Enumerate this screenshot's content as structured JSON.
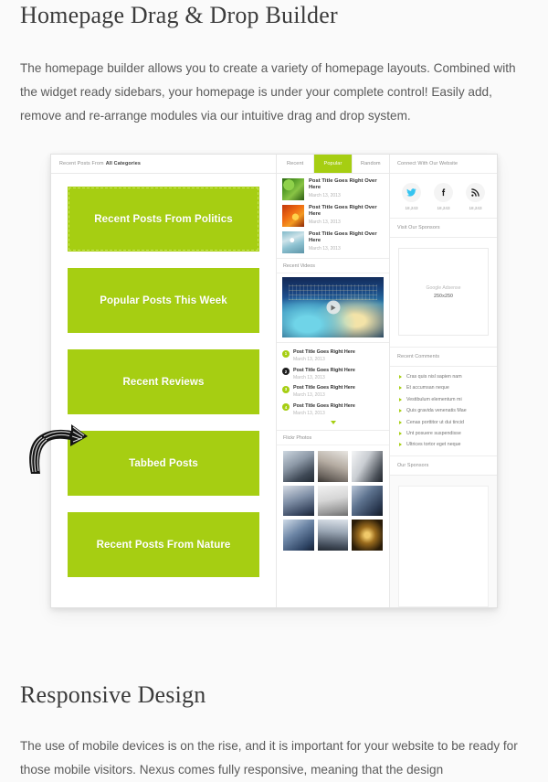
{
  "sections": {
    "top": {
      "title": "Homepage Drag & Drop Builder",
      "body": "The homepage builder allows you to create a variety of homepage layouts. Combined with the widget ready sidebars, your homepage is under your complete control! Easily add, remove and re-arrange modules via our intuitive drag and drop system."
    },
    "bottom": {
      "title": "Responsive Design",
      "body": "The use of mobile devices is on the rise, and it is important for your website to be ready for those mobile visitors. Nexus comes fully responsive, meaning that the design"
    }
  },
  "mockup": {
    "left_column": {
      "header_prefix": "Recent Posts From",
      "header_strong": "All Categories",
      "blocks": [
        {
          "label": "Recent Posts From Politics"
        },
        {
          "label": "Popular Posts This Week"
        },
        {
          "label": "Recent Reviews"
        },
        {
          "label": "Tabbed Posts"
        },
        {
          "label": "Recent Posts From Nature"
        }
      ]
    },
    "middle_column": {
      "tabs": [
        {
          "label": "Recent",
          "active": false
        },
        {
          "label": "Popular",
          "active": true
        },
        {
          "label": "Random",
          "active": false
        }
      ],
      "tab_posts": [
        {
          "title": "Post Title Goes Right Over Here",
          "date": "March 13, 2013",
          "thumb": "leaves-thumbnail"
        },
        {
          "title": "Post Title Goes Right Over Here",
          "date": "March 13, 2013",
          "thumb": "fire-thumbnail"
        },
        {
          "title": "Post Title Goes Right Over Here",
          "date": "March 13, 2013",
          "thumb": "winter-thumbnail"
        }
      ],
      "videos_header": "Recent Videos",
      "video": {
        "caption": "city-night-video-thumbnail",
        "play_icon": "play-icon"
      },
      "numbered_posts": [
        {
          "num": "1",
          "title": "Post Title Goes Right Here",
          "date": "March 13, 2013",
          "dark": false
        },
        {
          "num": "2",
          "title": "Post Title Goes Right Here",
          "date": "March 13, 2013",
          "dark": true
        },
        {
          "num": "3",
          "title": "Post Title Goes Right Here",
          "date": "March 13, 2013",
          "dark": false
        },
        {
          "num": "4",
          "title": "Post Title Goes Right Here",
          "date": "March 13, 2013",
          "dark": false
        }
      ],
      "flickr_header": "Flickr Photos",
      "flickr_count": 9
    },
    "right_column": {
      "connect_header": "Connect With Our Website",
      "socials": [
        {
          "icon": "twitter-icon",
          "count": "18,243",
          "color": "#35c4f0"
        },
        {
          "icon": "facebook-icon",
          "count": "18,243",
          "color": "#1c1c1c"
        },
        {
          "icon": "rss-icon",
          "count": "18,243",
          "color": "#1c1c1c"
        }
      ],
      "sponsors_header": "Visit Our Sponsors",
      "ad": {
        "line1": "Google Adsense",
        "line2": "250x250"
      },
      "comments_header": "Recent Comments",
      "comments": [
        "Cras quis nisl sapien nam",
        "Et accumsan neque",
        "Vestibulum elementum mi",
        "Quis gravida venenatis Mae",
        "Cenas porttitor ut dui tincid",
        "Unt posuere suspendisse",
        "Ultrices tortor eget neque"
      ],
      "our_sponsors_header": "Our Sponsors"
    }
  },
  "colors": {
    "accent_green": "#a6ce12",
    "page_bg": "#fafafa",
    "twitter_blue": "#35c4f0"
  }
}
